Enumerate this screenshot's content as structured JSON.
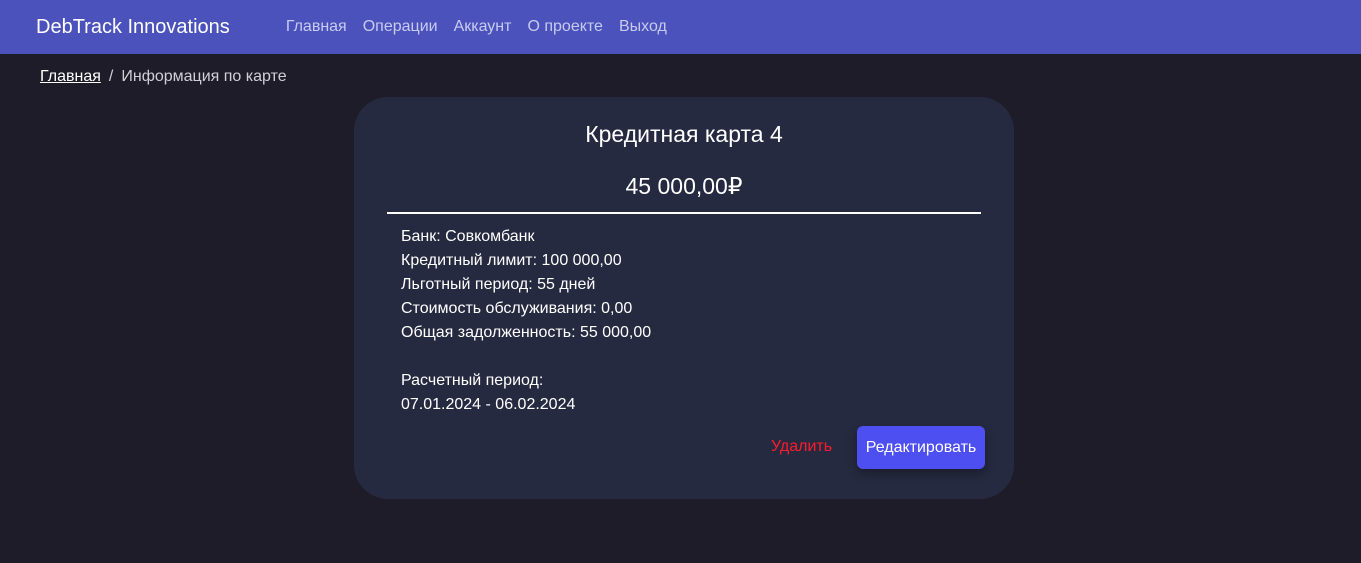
{
  "navbar": {
    "brand": "DebTrack Innovations",
    "links": [
      "Главная",
      "Операции",
      "Аккаунт",
      "О проекте",
      "Выход"
    ]
  },
  "breadcrumb": {
    "home": "Главная",
    "separator": "/",
    "current": "Информация по карте"
  },
  "card": {
    "title": "Кредитная карта 4",
    "amount": "45 000,00₽",
    "details": [
      "Банк: Совкомбанк",
      "Кредитный лимит: 100 000,00",
      "Льготный период: 55 дней",
      "Стоимость обслуживания: 0,00",
      "Общая задолженность: 55 000,00"
    ],
    "period_label": "Расчетный период:",
    "period_value": "07.01.2024 - 06.02.2024",
    "delete_label": "Удалить",
    "edit_label": "Редактировать"
  },
  "colors": {
    "navbar": "#4b52bb",
    "background": "#1e1c28",
    "card": "#262a40",
    "delete": "#ff1a2a",
    "edit_button": "#4e4ff0"
  }
}
